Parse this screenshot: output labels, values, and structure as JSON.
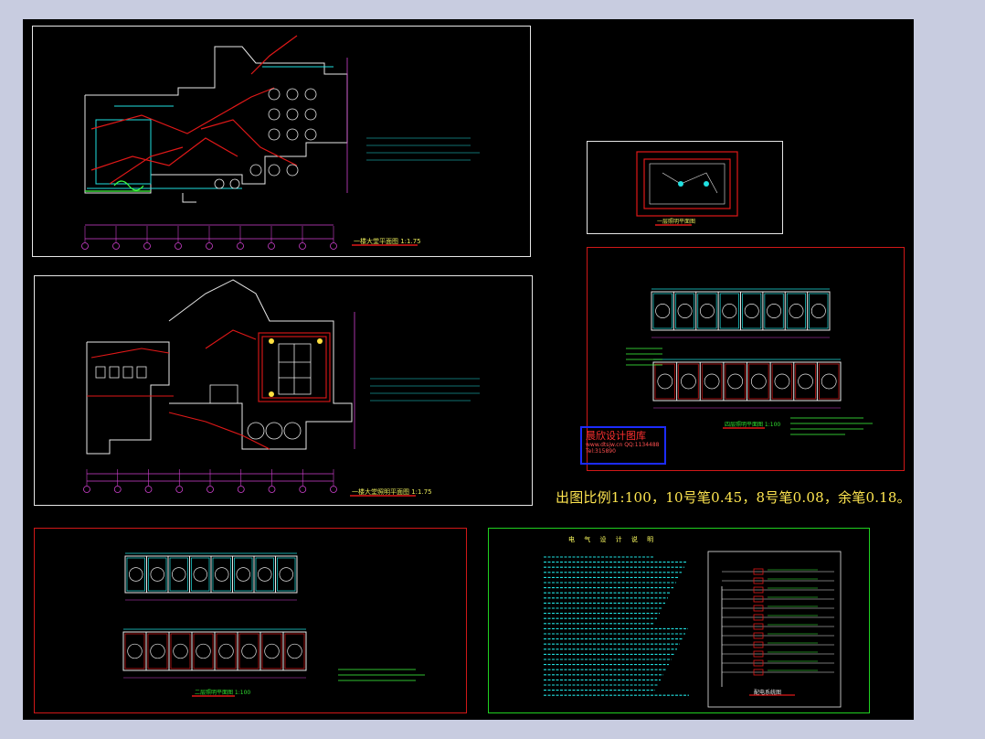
{
  "watermark": {
    "title": "晨欣设计图库",
    "sub": "www.dtsjw.cn  QQ:1134488  Tel:315890"
  },
  "note": "出图比例1:100，10号笔0.45，8号笔0.08，余笔0.18。",
  "captions": {
    "plan1": "一楼大堂平面图 1:1.75",
    "plan2": "一楼大堂照明平面图 1:1.75",
    "plan3": "一层照明平面图",
    "plan4": "四层照明平面图 1:100",
    "plan5": "二层照明平面图 1:100",
    "spec_title": "电 气 设 计 说 明",
    "system": "配电系统图"
  },
  "colors": {
    "canvas": "#000000",
    "desktop": "#c8cce0",
    "accent_red": "#d01818",
    "accent_green": "#20d020",
    "accent_cyan": "#20e0e0",
    "note_yellow": "#ffe650",
    "watermark_blue": "#1c2cff"
  }
}
